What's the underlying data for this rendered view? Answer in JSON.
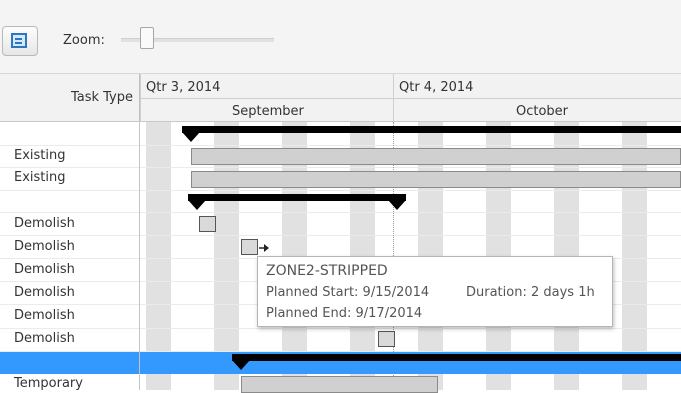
{
  "toolbar": {
    "zoom_label": "Zoom:",
    "zoom_level": 0.17
  },
  "grid": {
    "header_label": "Task Type",
    "rows": [
      {
        "label": ""
      },
      {
        "label": "Existing"
      },
      {
        "label": "Existing"
      },
      {
        "label": ""
      },
      {
        "label": "Demolish"
      },
      {
        "label": "Demolish"
      },
      {
        "label": "Demolish"
      },
      {
        "label": "Demolish"
      },
      {
        "label": "Demolish"
      },
      {
        "label": "Demolish"
      },
      {
        "label": ""
      },
      {
        "label": "Temporary"
      }
    ]
  },
  "timeline": {
    "quarters": [
      {
        "label": "Qtr 3, 2014"
      },
      {
        "label": "Qtr 4, 2014"
      }
    ],
    "months": [
      {
        "label": "September"
      },
      {
        "label": "October"
      }
    ]
  },
  "tooltip": {
    "task_name": "ZONE2-STRIPPED",
    "planned_start": "Planned Start: 9/15/2014",
    "duration": "Duration: 2 days 1h",
    "planned_end": "Planned End: 9/17/2014"
  },
  "colors": {
    "selection": "#3399ff",
    "summary_bar": "#000000",
    "task_bar": "#d0d0d0",
    "weekend_band": "#e1e1e1"
  }
}
